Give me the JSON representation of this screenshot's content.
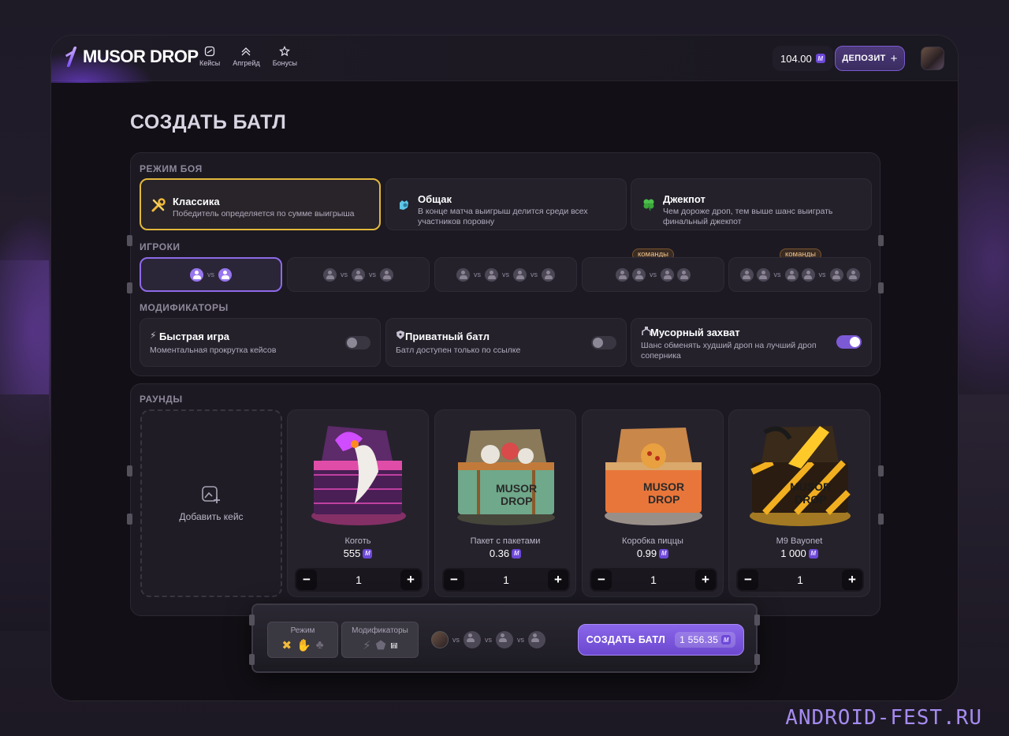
{
  "header": {
    "logo": "MUSOR DROP",
    "nav": [
      {
        "label": "Кейсы",
        "icon": "cases-icon"
      },
      {
        "label": "Апгрейд",
        "icon": "upgrade-icon"
      },
      {
        "label": "Бонусы",
        "icon": "bonus-icon"
      }
    ],
    "balance": "104.00",
    "currency_symbol": "M",
    "deposit_label": "ДЕПОЗИТ"
  },
  "page_title": "СОЗДАТЬ БАТЛ",
  "battle_mode": {
    "section_label": "РЕЖИМ БОЯ",
    "modes": [
      {
        "title": "Классика",
        "desc": "Победитель определяется по сумме выигрыша",
        "icon": "tools-icon",
        "selected": true
      },
      {
        "title": "Общак",
        "desc": "В конце матча выигрыш делится среди всех участников поровну",
        "icon": "hand-icon",
        "selected": false
      },
      {
        "title": "Джекпот",
        "desc": "Чем дороже дроп, тем выше шанс выиграть финальный джекпот",
        "icon": "clover-icon",
        "selected": false
      }
    ]
  },
  "players": {
    "section_label": "ИГРОКИ",
    "vs": "vs",
    "teams_label": "команды",
    "options": [
      {
        "groups": [
          1,
          1
        ],
        "selected": true,
        "teams": false
      },
      {
        "groups": [
          1,
          1,
          1
        ],
        "selected": false,
        "teams": false
      },
      {
        "groups": [
          1,
          1,
          1,
          1
        ],
        "selected": false,
        "teams": false
      },
      {
        "groups": [
          2,
          2
        ],
        "selected": false,
        "teams": true
      },
      {
        "groups": [
          2,
          2,
          2
        ],
        "selected": false,
        "teams": true
      }
    ]
  },
  "modifiers": {
    "section_label": "МОДИФИКАТОРЫ",
    "items": [
      {
        "title": "Быстрая игра",
        "desc": "Моментальная прокрутка кейсов",
        "icon": "lightning-icon",
        "enabled": false
      },
      {
        "title": "Приватный батл",
        "desc": "Батл доступен только по ссылке",
        "icon": "shield-icon",
        "enabled": false
      },
      {
        "title": "Мусорный захват",
        "desc": "Шанс обменять худший дроп на лучший дроп соперника",
        "icon": "claw-icon",
        "enabled": true
      }
    ]
  },
  "rounds": {
    "section_label": "РАУНДЫ",
    "add_case_label": "Добавить кейс",
    "cases": [
      {
        "name": "Коготь",
        "price": "555",
        "qty": "1",
        "theme": "pink"
      },
      {
        "name": "Пакет с пакетами",
        "price": "0.36",
        "qty": "1",
        "theme": "green"
      },
      {
        "name": "Коробка пиццы",
        "price": "0.99",
        "qty": "1",
        "theme": "orange"
      },
      {
        "name": "M9 Bayonet",
        "price": "1 000",
        "qty": "1",
        "theme": "gold"
      }
    ]
  },
  "summary_bar": {
    "mode_label": "Режим",
    "modifiers_label": "Модификаторы",
    "vs": "vs",
    "create_label": "СОЗДАТЬ БАТЛ",
    "total": "1 556.35"
  },
  "watermark": "ANDROID-FEST.RU",
  "colors": {
    "accent": "#7c5ad6",
    "selected_mode_border": "#e2b83c",
    "background": "#121016"
  }
}
